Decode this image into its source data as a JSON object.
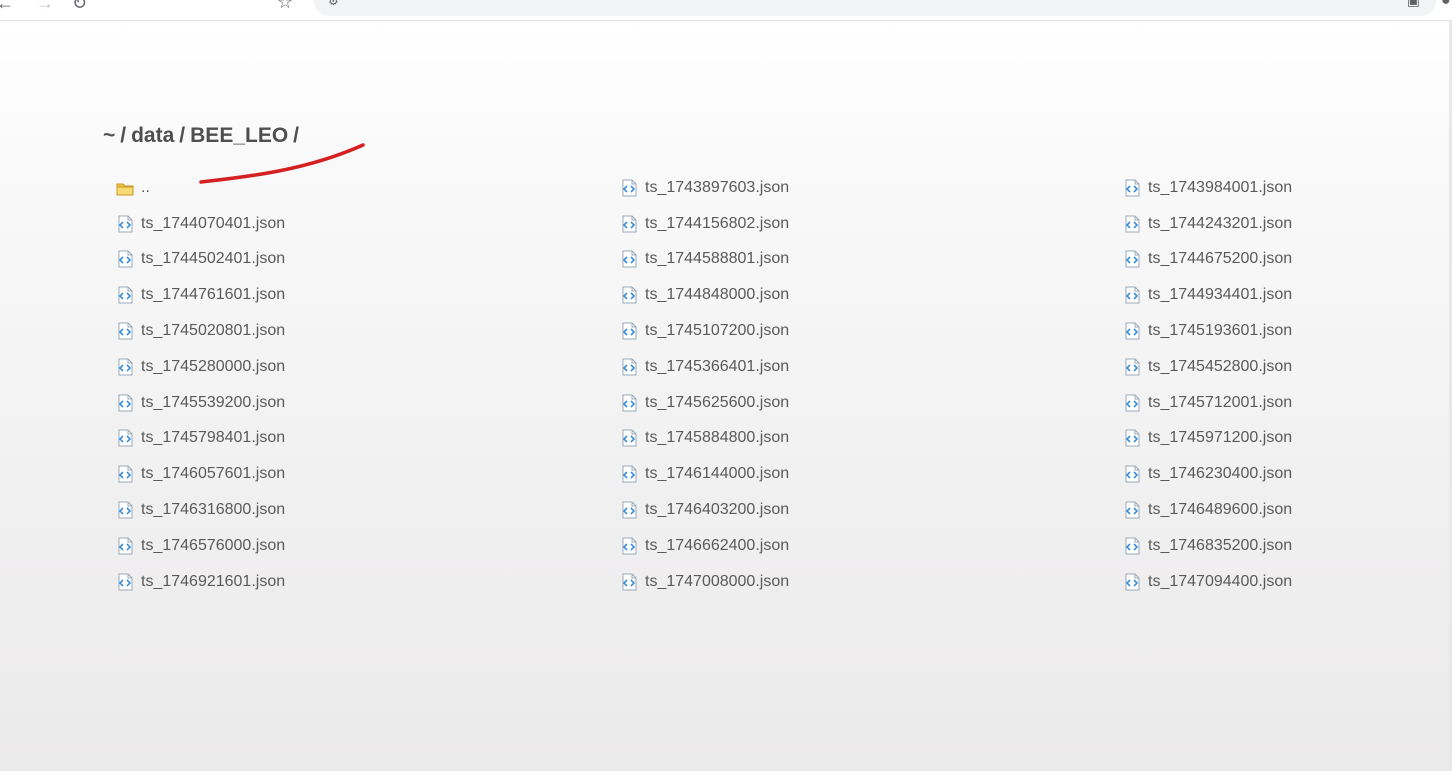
{
  "browser": {
    "url": "",
    "icons": {
      "back": "back-arrow-icon",
      "forward": "forward-arrow-icon",
      "reload": "reload-icon",
      "bookmark": "bookmark-icon",
      "site_info": "site-info-icon",
      "share": "share-icon",
      "profile": "profile-icon"
    }
  },
  "breadcrumb": {
    "parts": [
      "~",
      "/",
      "data",
      "/",
      "BEE_LEO",
      "/"
    ]
  },
  "annotation": {
    "color": "#d42020"
  },
  "listing": {
    "parent_label": "..",
    "files": [
      "ts_1743897603.json",
      "ts_1743984001.json",
      "ts_1744070401.json",
      "ts_1744156802.json",
      "ts_1744243201.json",
      "ts_1744502401.json",
      "ts_1744588801.json",
      "ts_1744675200.json",
      "ts_1744761601.json",
      "ts_1744848000.json",
      "ts_1744934401.json",
      "ts_1745020801.json",
      "ts_1745107200.json",
      "ts_1745193601.json",
      "ts_1745280000.json",
      "ts_1745366401.json",
      "ts_1745452800.json",
      "ts_1745539200.json",
      "ts_1745625600.json",
      "ts_1745712001.json",
      "ts_1745798401.json",
      "ts_1745884800.json",
      "ts_1745971200.json",
      "ts_1746057601.json",
      "ts_1746144000.json",
      "ts_1746230400.json",
      "ts_1746316800.json",
      "ts_1746403200.json",
      "ts_1746489600.json",
      "ts_1746576000.json",
      "ts_1746662400.json",
      "ts_1746835200.json",
      "ts_1746921601.json",
      "ts_1747008000.json",
      "ts_1747094400.json"
    ],
    "folder_icon": "folder-icon",
    "file_icon": "json-file-icon",
    "colors": {
      "folder": "#f0c24a",
      "file_accent": "#3a8fd8"
    }
  }
}
